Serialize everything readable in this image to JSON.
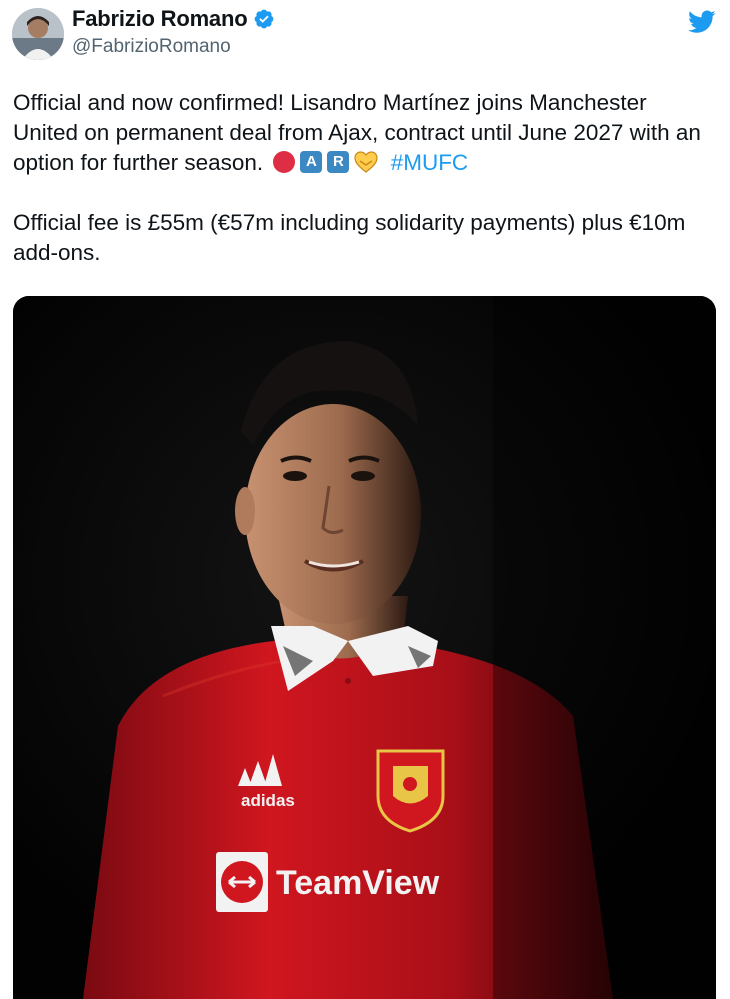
{
  "tweet": {
    "author": {
      "display_name": "Fabrizio Romano",
      "handle": "@FabrizioRomano",
      "verified": true,
      "avatar_icon": "avatar-photo"
    },
    "text_line1_before_emoji": "Official and now confirmed! Lisandro Martínez joins Manchester United on permanent deal from Ajax, contract until June 2027 with an option for further season.",
    "emojis": {
      "red_circle": "red-circle-emoji",
      "letter_a": "A",
      "letter_r": "R",
      "handshake": "handshake-emoji"
    },
    "hashtag": "#MUFC",
    "text_paragraph2": "Official fee is £55m (€57m including solidarity payments) plus €10m add-ons.",
    "media": {
      "kit_brand": "adidas",
      "sponsor": "TeamViewer",
      "visible_sponsor_text": "TeamView"
    }
  },
  "colors": {
    "brand_blue": "#1d9bf0",
    "verified_blue": "#1d9bf0",
    "text": "#0f1419",
    "secondary_text": "#536471",
    "shirt_red": "#c8102e"
  }
}
